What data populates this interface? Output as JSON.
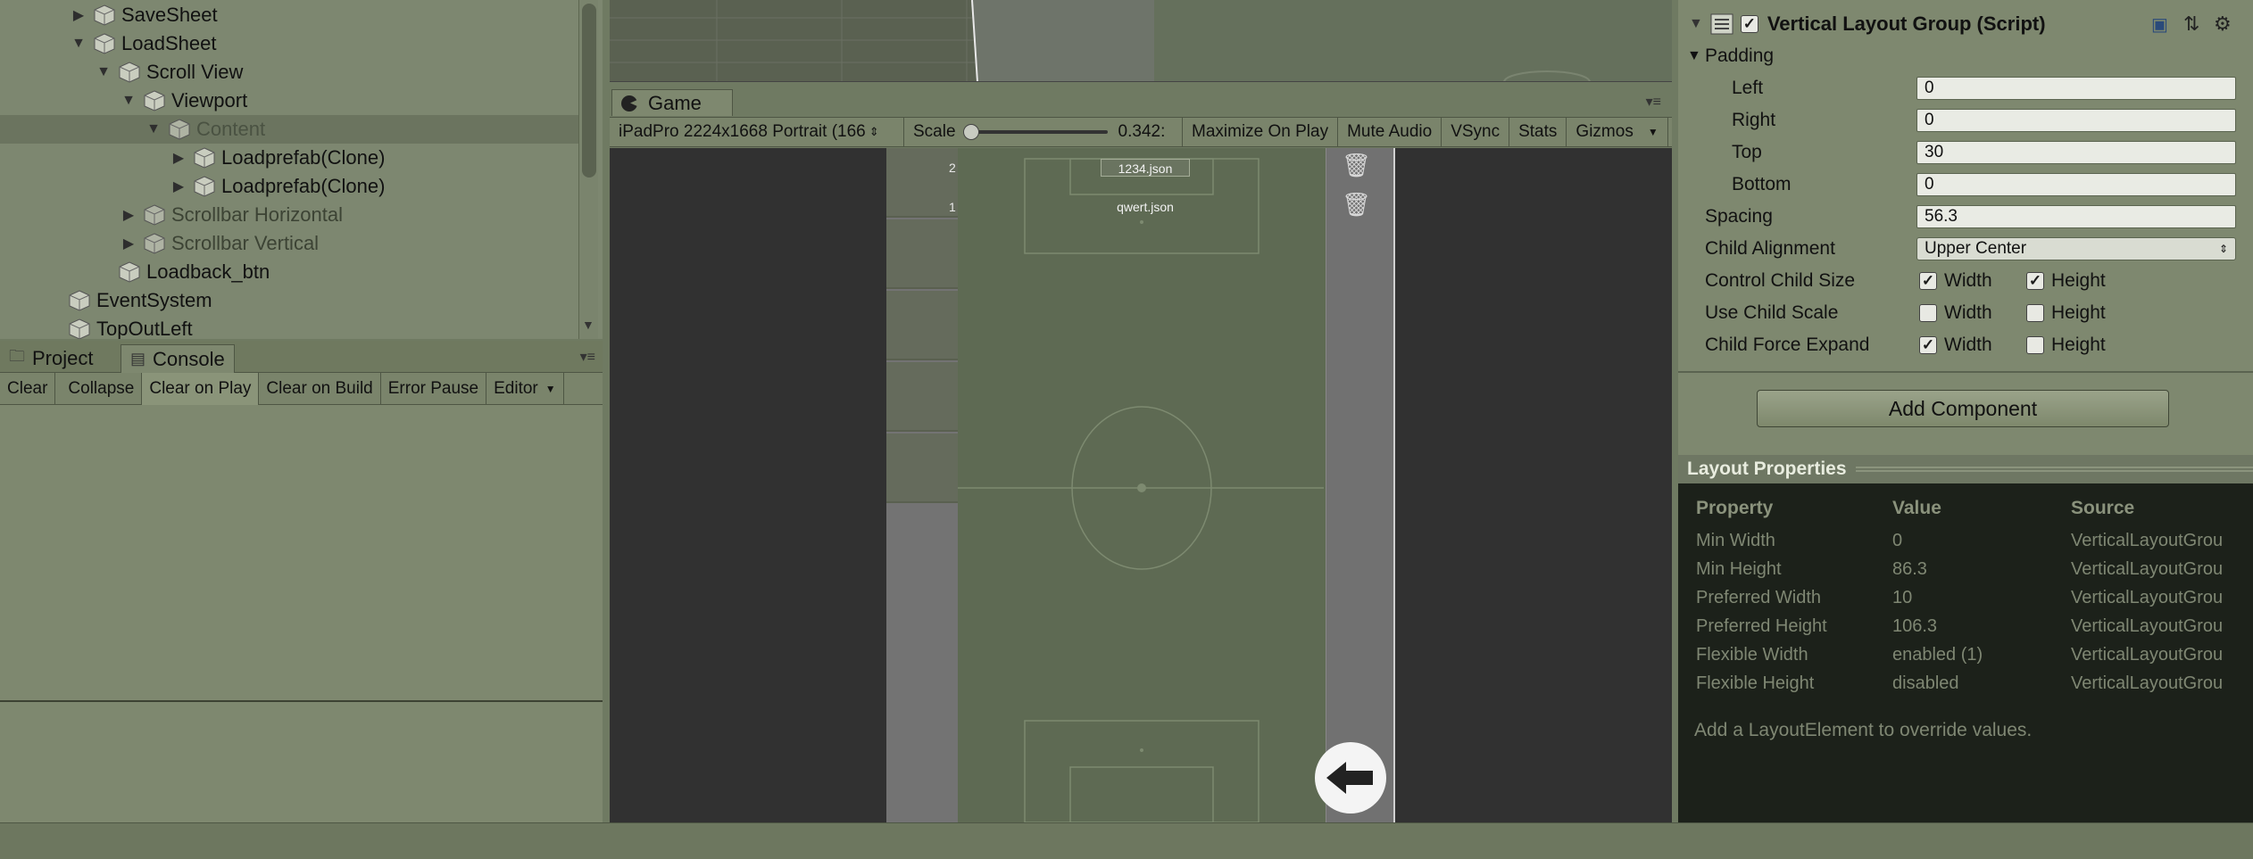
{
  "hierarchy": {
    "items": [
      {
        "label": "SaveSheet"
      },
      {
        "label": "LoadSheet"
      },
      {
        "label": "Scroll View"
      },
      {
        "label": "Viewport"
      },
      {
        "label": "Content"
      },
      {
        "label": "Loadprefab(Clone)"
      },
      {
        "label": "Loadprefab(Clone)"
      },
      {
        "label": "Scrollbar Horizontal"
      },
      {
        "label": "Scrollbar Vertical"
      },
      {
        "label": "Loadback_btn"
      },
      {
        "label": "EventSystem"
      },
      {
        "label": "TopOutLeft"
      }
    ]
  },
  "bottom_tabs": {
    "project": "Project",
    "console": "Console"
  },
  "console_toolbar": {
    "clear": "Clear",
    "collapse": "Collapse",
    "clear_on_play": "Clear on Play",
    "clear_on_build": "Clear on Build",
    "error_pause": "Error Pause",
    "editor": "Editor"
  },
  "game": {
    "tab_label": "Game",
    "resolution": "iPadPro 2224x1668 Portrait (166",
    "scale_label": "Scale",
    "scale_value": "0.342:",
    "maximize_on_play": "Maximize On Play",
    "mute_audio": "Mute Audio",
    "vsync": "VSync",
    "stats": "Stats",
    "gizmos": "Gizmos",
    "rows": [
      {
        "num": "2",
        "file": "1234.json"
      },
      {
        "num": "1",
        "file": "qwert.json"
      }
    ]
  },
  "inspector": {
    "component_title": "Vertical Layout Group (Script)",
    "padding_label": "Padding",
    "left_label": "Left",
    "left_value": "0",
    "right_label": "Right",
    "right_value": "0",
    "top_label": "Top",
    "top_value": "30",
    "bottom_label": "Bottom",
    "bottom_value": "0",
    "spacing_label": "Spacing",
    "spacing_value": "56.3",
    "child_alignment_label": "Child Alignment",
    "child_alignment_value": "Upper Center",
    "control_child_size_label": "Control Child Size",
    "use_child_scale_label": "Use Child Scale",
    "child_force_expand_label": "Child Force Expand",
    "width_label": "Width",
    "height_label": "Height",
    "control_child_size": {
      "width": true,
      "height": true
    },
    "use_child_scale": {
      "width": false,
      "height": false
    },
    "child_force_expand": {
      "width": true,
      "height": false
    },
    "add_component": "Add Component"
  },
  "layout_properties": {
    "title": "Layout Properties",
    "headers": {
      "property": "Property",
      "value": "Value",
      "source": "Source"
    },
    "rows": [
      {
        "property": "Min Width",
        "value": "0",
        "source": "VerticalLayoutGrou"
      },
      {
        "property": "Min Height",
        "value": "86.3",
        "source": "VerticalLayoutGrou"
      },
      {
        "property": "Preferred Width",
        "value": "10",
        "source": "VerticalLayoutGrou"
      },
      {
        "property": "Preferred Height",
        "value": "106.3",
        "source": "VerticalLayoutGrou"
      },
      {
        "property": "Flexible Width",
        "value": "enabled (1)",
        "source": "VerticalLayoutGrou"
      },
      {
        "property": "Flexible Height",
        "value": "disabled",
        "source": "VerticalLayoutGrou"
      }
    ],
    "hint": "Add a LayoutElement to override values."
  },
  "colors": {
    "editor_bg": "#7e886f",
    "selection": "#6b745f",
    "game_bg": "#313131",
    "pitch": "#5e6a53",
    "layout_panel_bg": "#1c211a"
  }
}
